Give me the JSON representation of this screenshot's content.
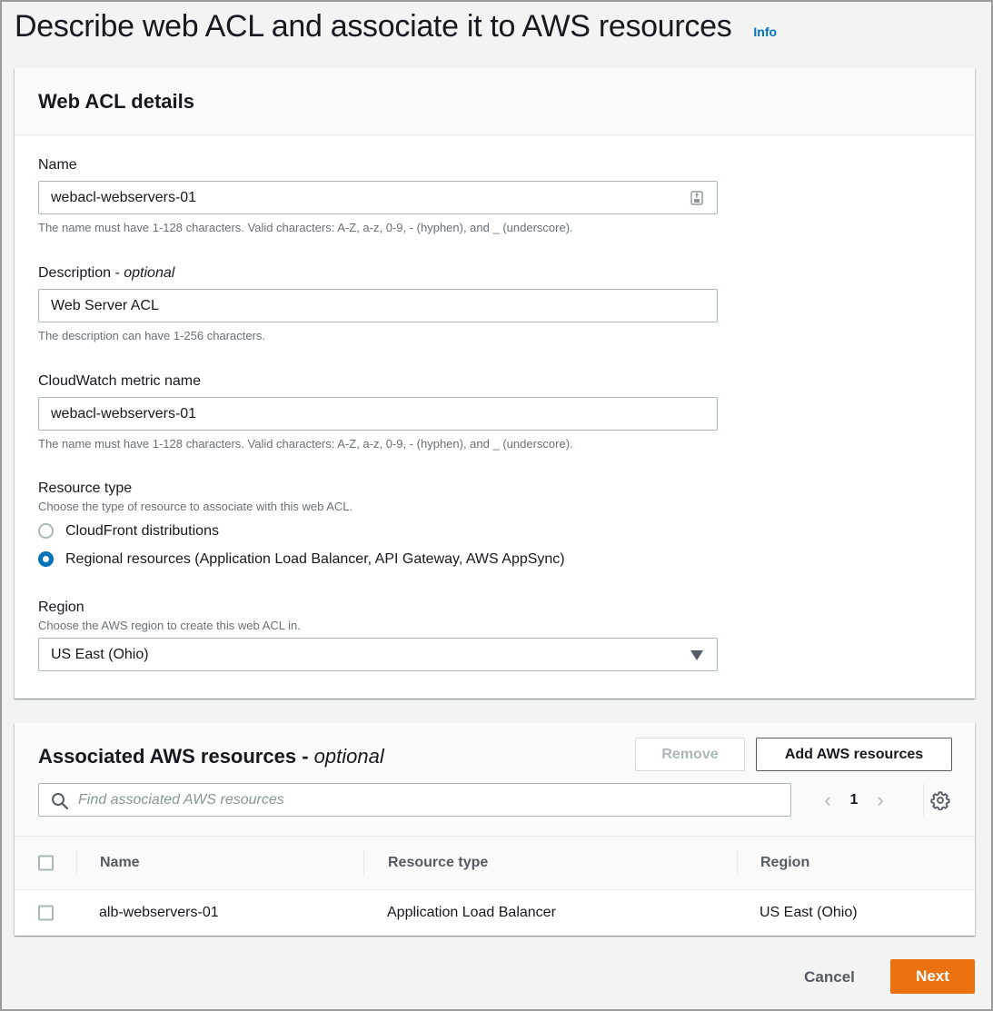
{
  "page": {
    "title": "Describe web ACL and associate it to AWS resources",
    "info_link": "Info"
  },
  "details": {
    "title": "Web ACL details",
    "name": {
      "label": "Name",
      "value": "webacl-webservers-01",
      "help": "The name must have 1-128 characters. Valid characters: A-Z, a-z, 0-9, - (hyphen), and _ (underscore)."
    },
    "description": {
      "label": "Description - ",
      "label_optional": "optional",
      "value": "Web Server ACL",
      "help": "The description can have 1-256 characters."
    },
    "metric": {
      "label": "CloudWatch metric name",
      "value": "webacl-webservers-01",
      "help": "The name must have 1-128 characters. Valid characters: A-Z, a-z, 0-9, - (hyphen), and _ (underscore)."
    },
    "resource_type": {
      "label": "Resource type",
      "description": "Choose the type of resource to associate with this web ACL.",
      "options": [
        {
          "label": "CloudFront distributions",
          "checked": false
        },
        {
          "label": "Regional resources (Application Load Balancer, API Gateway, AWS AppSync)",
          "checked": true
        }
      ]
    },
    "region": {
      "label": "Region",
      "description": "Choose the AWS region to create this web ACL in.",
      "selected": "US East (Ohio)"
    }
  },
  "resources": {
    "title": "Associated AWS resources - ",
    "title_optional": "optional",
    "remove_label": "Remove",
    "add_label": "Add AWS resources",
    "search_placeholder": "Find associated AWS resources",
    "page_number": "1",
    "columns": [
      "Name",
      "Resource type",
      "Region"
    ],
    "rows": [
      {
        "name": "alb-webservers-01",
        "type": "Application Load Balancer",
        "region": "US East (Ohio)"
      }
    ]
  },
  "footer": {
    "cancel_label": "Cancel",
    "next_label": "Next"
  },
  "colors": {
    "accent": "#0073bb",
    "primary_button": "#ec7211"
  }
}
